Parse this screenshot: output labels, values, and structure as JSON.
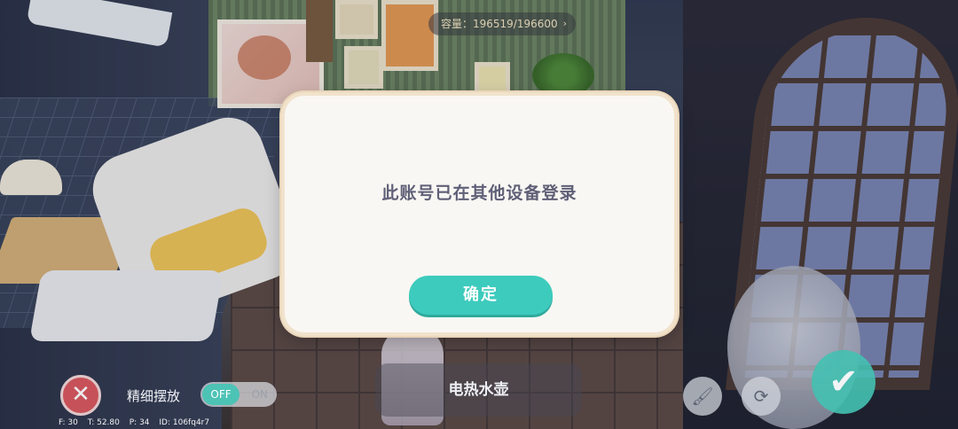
{
  "hud": {
    "capacity_text": "容量：196519/196600",
    "arrow": "›",
    "cancel_glyph": "✕",
    "fine_placement_label": "精细摆放",
    "toggle_off": "OFF",
    "toggle_on": "ON",
    "item_name": "电热水壶",
    "brush_glyph": "🖌",
    "rotate_glyph": "⟳",
    "confirm_glyph": "✔"
  },
  "debug": {
    "f": "F: 30",
    "t": "T: 52.80",
    "p": "P: 34",
    "id": "ID: 106fq4r7"
  },
  "dialog": {
    "message": "此账号已在其他设备登录",
    "ok_label": "确定"
  },
  "colors": {
    "accent": "#3dcbbd",
    "dialog_bg": "#f9f7f3",
    "cancel_red": "#d8555a"
  },
  "icons": {
    "cancel": "close-icon",
    "brush": "brush-icon",
    "rotate": "rotate-icon",
    "confirm": "checkmark-icon"
  }
}
